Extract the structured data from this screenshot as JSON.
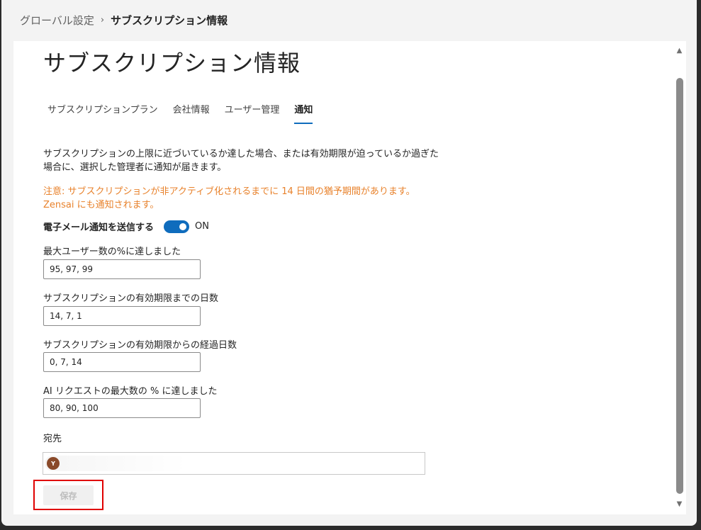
{
  "breadcrumb": {
    "parent": "グローバル設定",
    "separator": "›",
    "current": "サブスクリプション情報"
  },
  "page": {
    "title": "サブスクリプション情報"
  },
  "tabs": [
    {
      "label": "サブスクリプションプラン",
      "active": false
    },
    {
      "label": "会社情報",
      "active": false
    },
    {
      "label": "ユーザー管理",
      "active": false
    },
    {
      "label": "通知",
      "active": true
    }
  ],
  "notice": {
    "description": "サブスクリプションの上限に近づいているか達した場合、または有効期限が迫っているか過ぎた場合に、選択した管理者に通知が届きます。",
    "warning": "注意: サブスクリプションが非アクティブ化されるまでに 14 日間の猶予期間があります。Zensai にも通知されます。",
    "warning_color": "#e8822c"
  },
  "email_toggle": {
    "label": "電子メール通知を送信する",
    "state": "ON",
    "on": true,
    "accent": "#0f6cbd"
  },
  "fields": [
    {
      "label": "最大ユーザー数の%に達しました",
      "value": "95, 97, 99"
    },
    {
      "label": "サブスクリプションの有効期限までの日数",
      "value": "14, 7, 1"
    },
    {
      "label": "サブスクリプションの有効期限からの経過日数",
      "value": "0, 7, 14"
    },
    {
      "label": "AI リクエストの最大数の % に達しました",
      "value": "80, 90, 100"
    }
  ],
  "recipients": {
    "label": "宛先",
    "avatar_initial": "Y"
  },
  "actions": {
    "save_label": "保存"
  },
  "scrollbar": {
    "up": "▲",
    "down": "▼"
  }
}
